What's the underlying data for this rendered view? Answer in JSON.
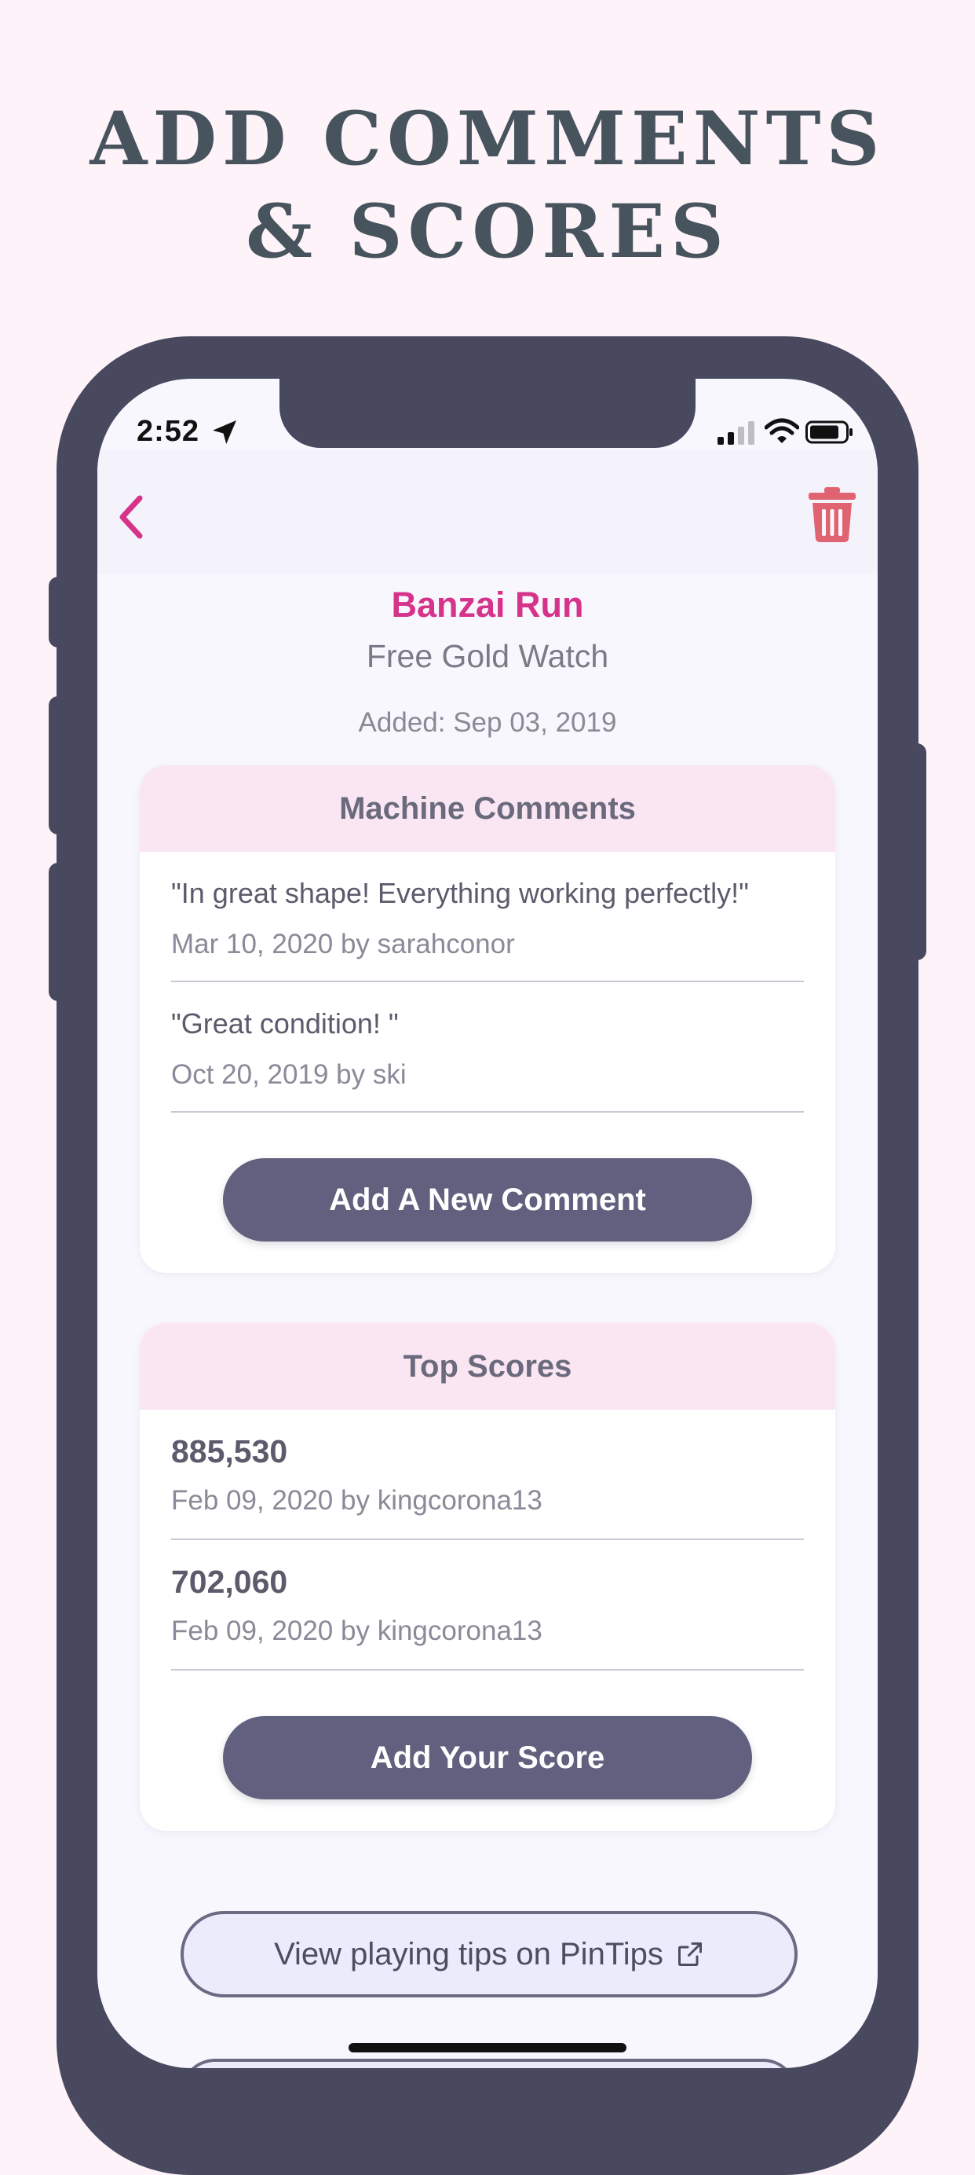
{
  "headline": {
    "line1": "ADD COMMENTS",
    "line2": "& SCORES"
  },
  "status_bar": {
    "time": "2:52"
  },
  "machine": {
    "name": "Banzai Run",
    "location": "Free Gold Watch",
    "added": "Added: Sep 03, 2019"
  },
  "comments": {
    "header": "Machine Comments",
    "items": [
      {
        "text": "\"In great shape! Everything working perfectly!\"",
        "meta": "Mar 10, 2020 by sarahconor"
      },
      {
        "text": "\"Great condition! \"",
        "meta": "Oct 20, 2019 by ski"
      }
    ],
    "add_button": "Add A New Comment"
  },
  "scores": {
    "header": "Top Scores",
    "items": [
      {
        "score": "885,530",
        "meta": "Feb 09, 2020 by kingcorona13"
      },
      {
        "score": "702,060",
        "meta": "Feb 09, 2020 by kingcorona13"
      }
    ],
    "add_button": "Add Your Score"
  },
  "tips_button": "View playing tips on PinTips",
  "colors": {
    "accent": "#d6338a",
    "button": "#61607f",
    "frame": "#48485e",
    "card_header": "#fae6f2",
    "trash": "#e06372"
  },
  "icons": {
    "back": "chevron-left-icon",
    "delete": "trash-icon",
    "external": "external-link-icon",
    "location": "location-arrow-icon",
    "signal": "cellular-signal-icon",
    "wifi": "wifi-icon",
    "battery": "battery-icon"
  }
}
